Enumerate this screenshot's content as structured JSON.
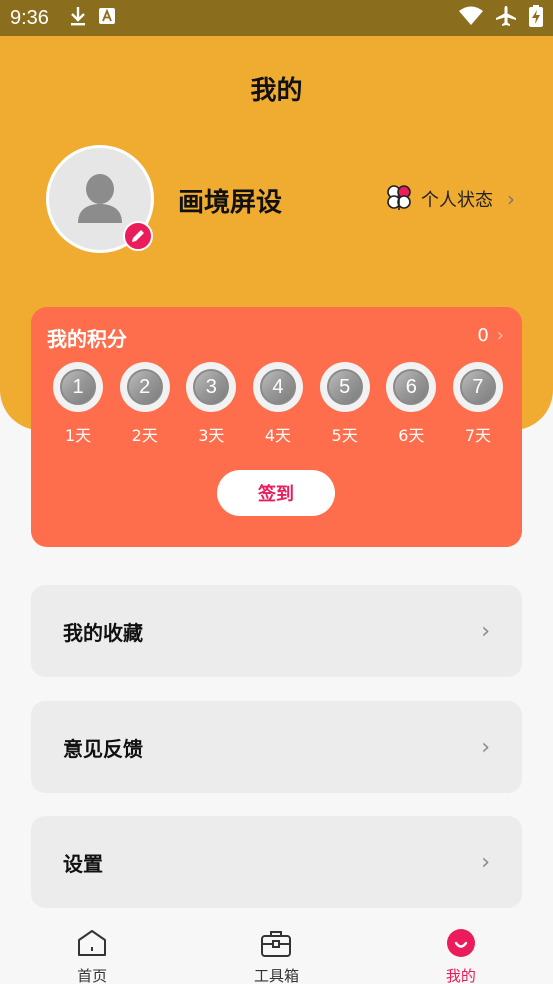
{
  "status_bar": {
    "time": "9:36"
  },
  "header": {
    "title": "我的",
    "username": "画境屏设",
    "status_label": "个人状态"
  },
  "points": {
    "title": "我的积分",
    "value": "0",
    "days": [
      {
        "num": "1",
        "label": "1天"
      },
      {
        "num": "2",
        "label": "2天"
      },
      {
        "num": "3",
        "label": "3天"
      },
      {
        "num": "4",
        "label": "4天"
      },
      {
        "num": "5",
        "label": "5天"
      },
      {
        "num": "6",
        "label": "6天"
      },
      {
        "num": "7",
        "label": "7天"
      }
    ],
    "sign_in_label": "签到"
  },
  "menu": [
    {
      "label": "我的收藏"
    },
    {
      "label": "意见反馈"
    },
    {
      "label": "设置"
    }
  ],
  "bottom_nav": [
    {
      "label": "首页",
      "icon": "home-icon"
    },
    {
      "label": "工具箱",
      "icon": "toolbox-icon"
    },
    {
      "label": "我的",
      "icon": "profile-icon",
      "active": true
    }
  ],
  "colors": {
    "header_bg": "#f0ac30",
    "points_card": "#ff6e4c",
    "accent": "#ea1c5b",
    "menu_bg": "#ececec"
  }
}
